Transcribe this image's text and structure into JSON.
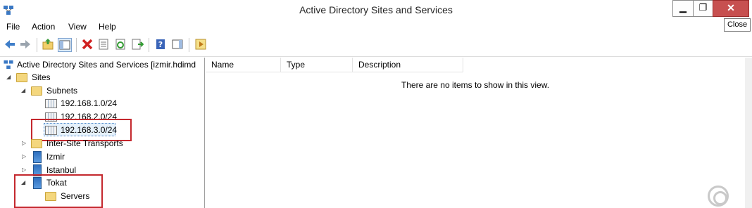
{
  "window": {
    "title": "Active Directory Sites and Services",
    "minimize_glyph": "▁",
    "maximize_glyph": "❐",
    "close_glyph": "✕",
    "close_tooltip": "Close"
  },
  "menu": [
    "File",
    "Action",
    "View",
    "Help"
  ],
  "toolbar_icons": [
    "back-arrow-icon",
    "forward-arrow-icon",
    "up-folder-icon",
    "show-hide-console-tree-icon",
    "delete-icon",
    "properties-icon",
    "refresh-icon",
    "export-list-icon",
    "help-icon",
    "show-hide-action-pane-icon",
    "run-icon"
  ],
  "tree": {
    "root": "Active Directory Sites and Services [izmir.hdimd",
    "sites": "Sites",
    "subnets": "Subnets",
    "subnet_items": [
      "192.168.1.0/24",
      "192.168.2.0/24",
      "192.168.3.0/24"
    ],
    "inter_site": "Inter-Site Transports",
    "site_items": [
      "Izmir",
      "Istanbul",
      "Tokat"
    ],
    "servers": "Servers"
  },
  "list": {
    "columns": [
      "Name",
      "Type",
      "Description"
    ],
    "empty_message": "There are no items to show in this view."
  },
  "colors": {
    "highlight": "#c4282e",
    "close_button": "#c75050"
  }
}
